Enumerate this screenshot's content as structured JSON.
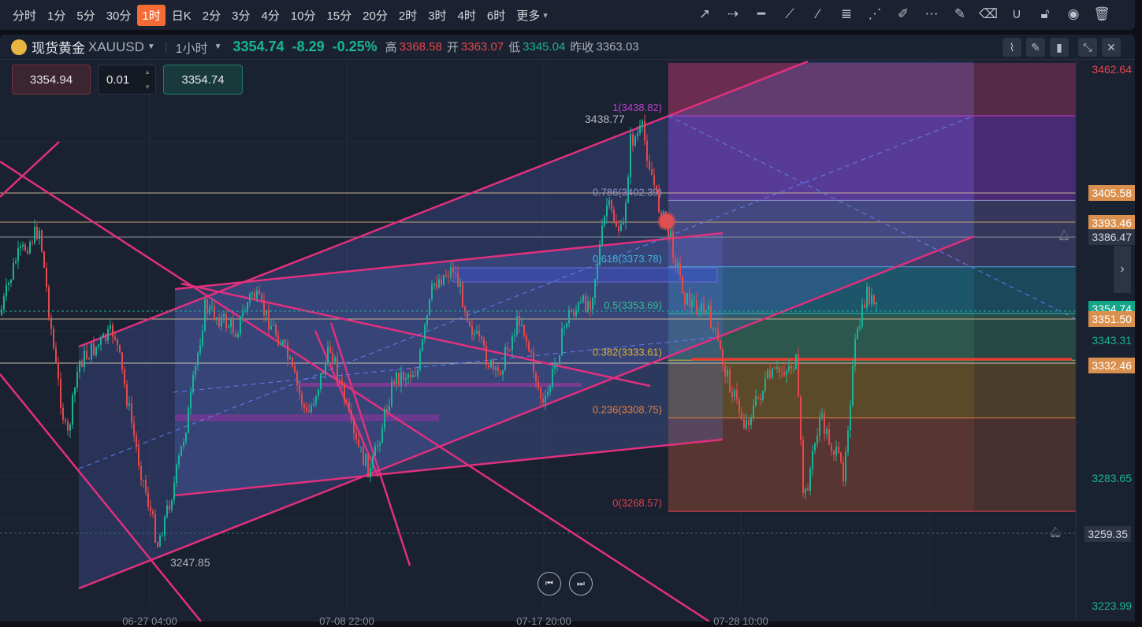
{
  "timeframes": [
    "分时",
    "1分",
    "5分",
    "30分",
    "1时",
    "日K",
    "2分",
    "3分",
    "4分",
    "10分",
    "15分",
    "20分",
    "2时",
    "3时",
    "4时",
    "6时",
    "更多"
  ],
  "active_timeframe": "1时",
  "tools": [
    "trend-line-icon",
    "ray-icon",
    "horizontal-line-icon",
    "segment-icon",
    "extended-line-icon",
    "fibonacci-icon",
    "fan-icon",
    "highlighter-icon",
    "more-icon",
    "note-icon",
    "eraser-icon",
    "magnet-icon",
    "unlock-icon",
    "eye-icon",
    "trash-icon"
  ],
  "header": {
    "name": "现货黄金",
    "symbol": "XAUUSD",
    "interval": "1小时",
    "price": "3354.74",
    "change": "-8.29",
    "change_pct": "-0.25%",
    "high_label": "高",
    "high": "3368.58",
    "open_label": "开",
    "open": "3363.07",
    "low_label": "低",
    "low": "3345.04",
    "prev_label": "昨收",
    "prev": "3363.03"
  },
  "order": {
    "sell": "3354.94",
    "qty": "0.01",
    "buy": "3354.74"
  },
  "fib": [
    {
      "label": "1(3438.82)",
      "price": 3438.82,
      "color": "#c040d0"
    },
    {
      "label": "0.786(3402.39)",
      "price": 3402.39,
      "color": "#9090c8"
    },
    {
      "label": "0.618(3373.78)",
      "price": 3373.78,
      "color": "#40b0e0"
    },
    {
      "label": "0.5(3353.69)",
      "price": 3353.69,
      "color": "#30c090"
    },
    {
      "label": "0.382(3333.61)",
      "price": 3333.61,
      "color": "#e0b030"
    },
    {
      "label": "0.236(3308.75)",
      "price": 3308.75,
      "color": "#e08040"
    },
    {
      "label": "0(3268.57)",
      "price": 3268.57,
      "color": "#e04050"
    }
  ],
  "annotations": {
    "high": "3438.77",
    "low": "3247.85"
  },
  "price_axis": [
    {
      "v": "3462.64",
      "style": "red"
    },
    {
      "v": "3405.58",
      "style": "orange"
    },
    {
      "v": "3393.46",
      "style": "orange"
    },
    {
      "v": "3386.47",
      "style": "gray"
    },
    {
      "v": "3354.74",
      "style": "green"
    },
    {
      "v": "3351.50",
      "style": "orange"
    },
    {
      "v": "3343.31",
      "style": "teal"
    },
    {
      "v": "3332.46",
      "style": "orange"
    },
    {
      "v": "3283.65",
      "style": "teal"
    },
    {
      "v": "3259.35",
      "style": "gray"
    },
    {
      "v": "3223.99",
      "style": "teal"
    }
  ],
  "time_axis": [
    "06-27 04:00",
    "07-08 22:00",
    "07-17 20:00",
    "07-28 10:00"
  ]
}
